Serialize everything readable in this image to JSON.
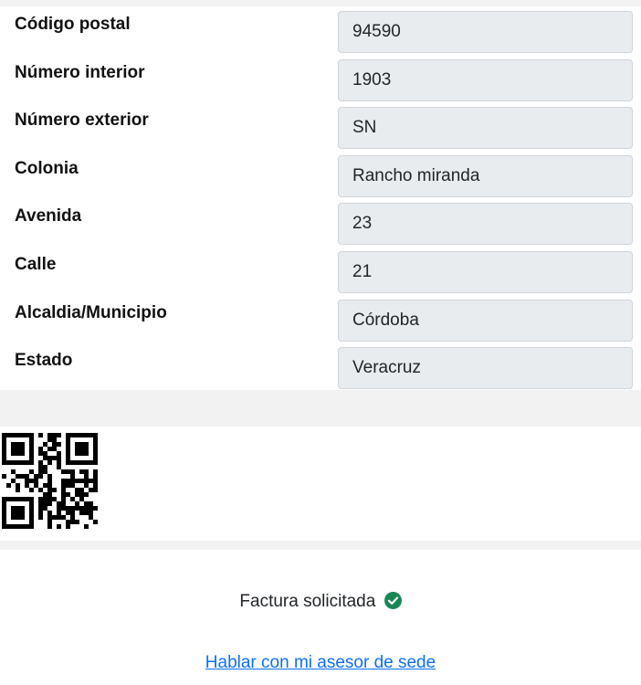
{
  "address_form": {
    "fields": [
      {
        "label": "Código postal",
        "value": "94590"
      },
      {
        "label": "Número interior",
        "value": "1903"
      },
      {
        "label": "Número exterior",
        "value": "SN"
      },
      {
        "label": "Colonia",
        "value": "Rancho miranda"
      },
      {
        "label": "Avenida",
        "value": "23"
      },
      {
        "label": "Calle",
        "value": "21"
      },
      {
        "label": "Alcaldia/Municipio",
        "value": "Córdoba"
      },
      {
        "label": "Estado",
        "value": "Veracruz"
      }
    ]
  },
  "qr": {
    "icon": "qr-code"
  },
  "status": {
    "text": "Factura solicitada",
    "icon": "check-circle-icon",
    "color": "#198754"
  },
  "advisor_link": {
    "label": "Hablar con mi asesor de sede",
    "color": "#0d6efd"
  }
}
